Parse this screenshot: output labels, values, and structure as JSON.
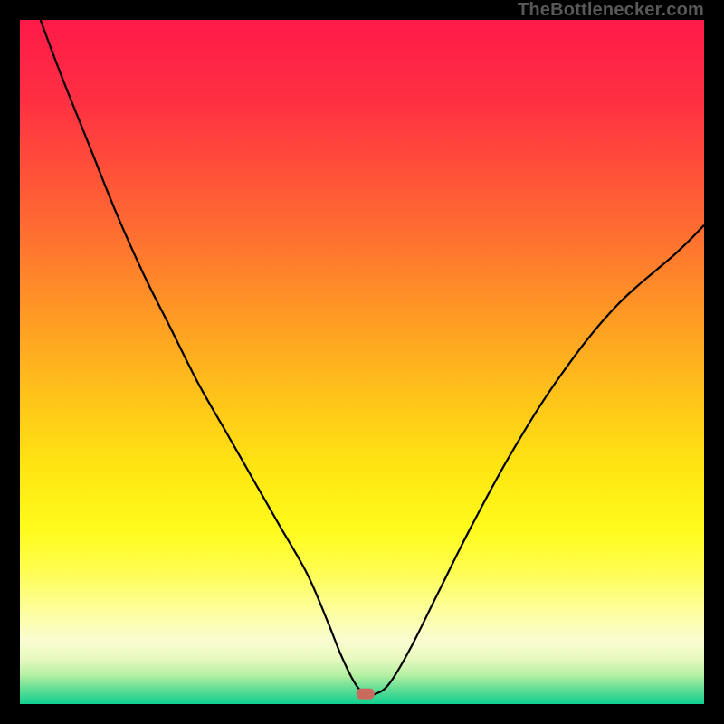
{
  "attribution": "TheBottlenecker.com",
  "gradient": {
    "stops": [
      {
        "offset": 0.0,
        "color": "#ff1a48"
      },
      {
        "offset": 0.12,
        "color": "#ff3042"
      },
      {
        "offset": 0.3,
        "color": "#ff6a32"
      },
      {
        "offset": 0.5,
        "color": "#ffb21e"
      },
      {
        "offset": 0.65,
        "color": "#ffe412"
      },
      {
        "offset": 0.74,
        "color": "#fffb1a"
      },
      {
        "offset": 0.8,
        "color": "#fffd4a"
      },
      {
        "offset": 0.86,
        "color": "#fdfe98"
      },
      {
        "offset": 0.905,
        "color": "#fafdd0"
      },
      {
        "offset": 0.934,
        "color": "#e8f9c0"
      },
      {
        "offset": 0.958,
        "color": "#b4f0a2"
      },
      {
        "offset": 0.978,
        "color": "#62dd95"
      },
      {
        "offset": 1.0,
        "color": "#11cf8f"
      }
    ]
  },
  "marker": {
    "x_frac": 0.505,
    "y_frac": 0.985,
    "color": "#c96a5f",
    "w": 20,
    "h": 12,
    "rx": 5
  },
  "chart_data": {
    "type": "line",
    "title": "",
    "xlabel": "",
    "ylabel": "",
    "xlim": [
      0,
      100
    ],
    "ylim": [
      0,
      100
    ],
    "grid": false,
    "series": [
      {
        "name": "bottleneck-curve",
        "x": [
          3,
          6,
          10,
          14,
          18,
          22,
          26,
          30,
          34,
          38,
          42,
          45,
          47,
          49,
          50.5,
          52,
          54,
          57,
          61,
          66,
          72,
          79,
          87,
          96,
          100
        ],
        "y": [
          100,
          92,
          82,
          72,
          63,
          55,
          47,
          40,
          33,
          26,
          19,
          12,
          7,
          3,
          1.5,
          1.5,
          3,
          8,
          16,
          26,
          37,
          48,
          58,
          66,
          70
        ]
      }
    ],
    "minimum_point": {
      "x": 50.5,
      "y": 1.5
    }
  }
}
